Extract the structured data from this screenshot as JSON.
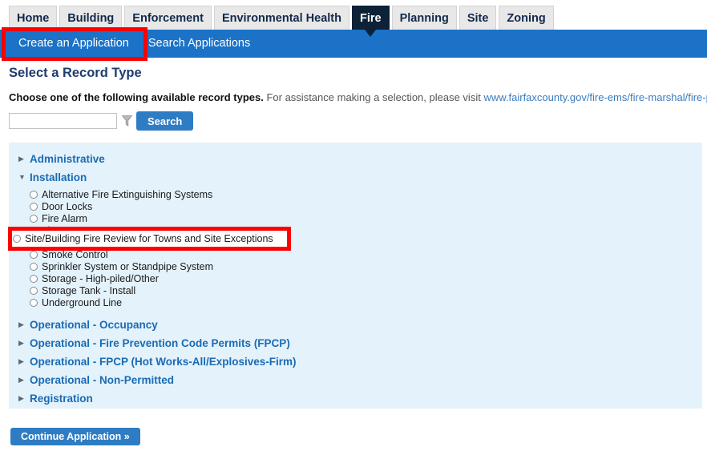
{
  "module_tabs": [
    {
      "label": "Home",
      "active": false
    },
    {
      "label": "Building",
      "active": false
    },
    {
      "label": "Enforcement",
      "active": false
    },
    {
      "label": "Environmental Health",
      "active": false
    },
    {
      "label": "Fire",
      "active": true
    },
    {
      "label": "Planning",
      "active": false
    },
    {
      "label": "Site",
      "active": false
    },
    {
      "label": "Zoning",
      "active": false
    }
  ],
  "subnav": {
    "items": [
      {
        "label": "Create an Application",
        "active": true
      },
      {
        "label": "Search Applications",
        "active": false
      }
    ]
  },
  "page": {
    "title": "Select a Record Type",
    "intro_strong": "Choose one of the following available record types.",
    "intro_rest": "For assistance making a selection, please visit",
    "intro_link": "www.fairfaxcounty.gov/fire-ems/fire-marshal/fire-plus",
    "intro_end": "."
  },
  "search": {
    "value": "",
    "placeholder": "",
    "filter_icon": "funnel-icon",
    "button_label": "Search"
  },
  "record_groups": [
    {
      "label": "Administrative",
      "expanded": false,
      "items": []
    },
    {
      "label": "Installation",
      "expanded": true,
      "items": [
        "Alternative Fire Extinguishing Systems",
        "Door Locks",
        "Fire Alarm",
        "Fire Lane",
        "Site/Building Fire Review for Towns and Site Exceptions",
        "Smoke Control",
        "Sprinkler System or Standpipe System",
        "Storage - High-piled/Other",
        "Storage Tank - Install",
        "Underground Line"
      ]
    },
    {
      "label": "Operational - Occupancy",
      "expanded": false,
      "items": []
    },
    {
      "label": "Operational - Fire Prevention Code Permits (FPCP)",
      "expanded": false,
      "items": []
    },
    {
      "label": "Operational - FPCP (Hot Works-All/Explosives-Firm)",
      "expanded": false,
      "items": []
    },
    {
      "label": "Operational - Non-Permitted",
      "expanded": false,
      "items": []
    },
    {
      "label": "Registration",
      "expanded": false,
      "items": []
    }
  ],
  "footer": {
    "continue_label": "Continue Application »"
  },
  "annotations": {
    "highlight_1": "Create an Application",
    "highlight_2": "Site/Building Fire Review for Towns and Site Exceptions",
    "color": "#fe0000"
  },
  "colors": {
    "subnav_blue": "#1b72c7",
    "panel_blue": "#e4f2fb",
    "active_tab": "#0d2137",
    "link_blue": "#1a6bb5",
    "button_blue": "#2e7dc4",
    "heading_navy": "#1f3c6e"
  }
}
